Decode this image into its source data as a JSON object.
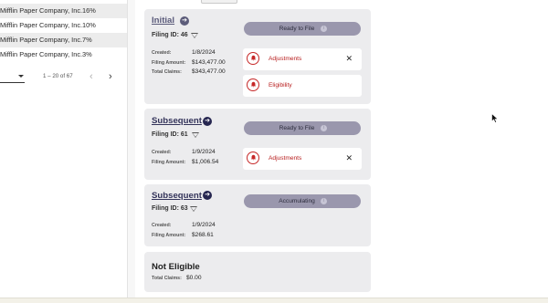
{
  "table": {
    "rows": [
      {
        "name": "Mifflin Paper Company, Inc.",
        "pct": "16%",
        "shaded": true
      },
      {
        "name": "Mifflin Paper Company, Inc.",
        "pct": "10%",
        "shaded": false
      },
      {
        "name": "Mifflin Paper Company, Inc.",
        "pct": "7%",
        "shaded": true
      },
      {
        "name": "Mifflin Paper Company, Inc.",
        "pct": "3%",
        "shaded": false
      }
    ]
  },
  "pagination": {
    "range": "1 – 20 of 67",
    "prev_icon": "chevron-left-icon",
    "next_icon": "chevron-right-icon"
  },
  "cards": [
    {
      "title": "Initial",
      "filing_id": "Filing ID: 46",
      "created_label": "Created:",
      "created": "1/8/2024",
      "amount_label": "Filing Amount:",
      "amount": "$143,477.00",
      "claims_label": "Total Claims:",
      "claims": "$343,477.00",
      "status": "Ready to File",
      "issues": [
        "Adjustments",
        "Eligibility"
      ]
    },
    {
      "title": "Subsequent",
      "filing_id": "Filing ID: 61",
      "created_label": "Created:",
      "created": "1/9/2024",
      "amount_label": "Filing Amount:",
      "amount": "$1,006.54",
      "status": "Ready to File",
      "issues": [
        "Adjustments"
      ]
    },
    {
      "title": "Subsequent",
      "filing_id": "Filing ID: 63",
      "created_label": "Created:",
      "created": "1/9/2024",
      "amount_label": "Filing Amount:",
      "amount": "$268.61",
      "status": "Accumulating"
    },
    {
      "title": "Not Eligible",
      "claims_label": "Total Claims:",
      "claims": "$0.00"
    }
  ],
  "colors": {
    "card_bg": "#ececee",
    "status_pill": "#9a97ad",
    "alert_red": "#c62828",
    "title_navy": "#33335a"
  },
  "icons": {
    "arrow": "arrow-right-circle-icon",
    "filter": "filter-icon",
    "info": "info-icon",
    "bell": "bell-icon",
    "close": "close-icon"
  }
}
